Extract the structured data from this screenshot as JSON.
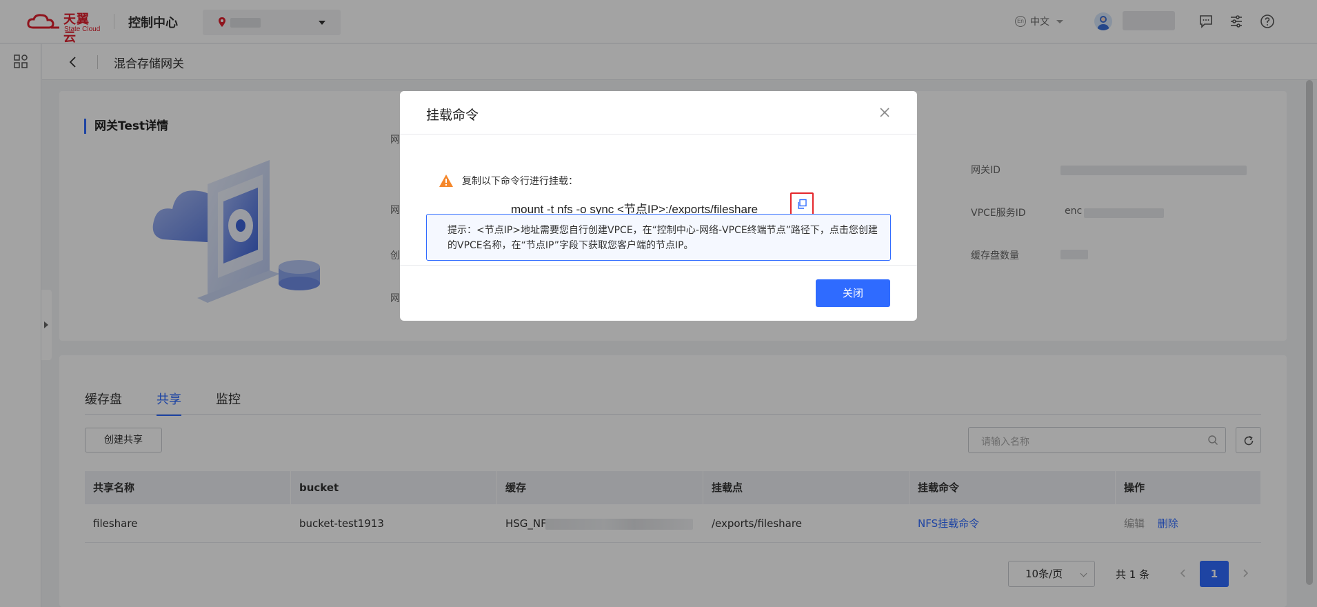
{
  "topbar": {
    "logo_cn": "天翼云",
    "logo_en": "State Cloud",
    "console_title": "控制中心",
    "language": "中文",
    "lang_badge": "En"
  },
  "subheader": {
    "title": "混合存储网关"
  },
  "detail": {
    "title": "网关Test详情",
    "labels_left": [
      "网",
      "网",
      "创",
      "网"
    ],
    "labels_right": [
      "网关ID",
      "VPCE服务ID",
      "缓存盘数量"
    ],
    "vpce_prefix": "enc"
  },
  "tabs": [
    {
      "label": "缓存盘",
      "active": false
    },
    {
      "label": "共享",
      "active": true
    },
    {
      "label": "监控",
      "active": false
    }
  ],
  "toolbar": {
    "create_label": "创建共享",
    "search_placeholder": "请输入名称"
  },
  "table": {
    "headers": [
      "共享名称",
      "bucket",
      "缓存",
      "挂载点",
      "挂载命令",
      "操作"
    ],
    "rows": [
      {
        "name": "fileshare",
        "bucket": "bucket-test1913",
        "cache": "HSG_NF",
        "mount_point": "/exports/fileshare",
        "mount_cmd": "NFS挂载命令",
        "op_edit": "编辑",
        "op_delete": "删除"
      }
    ]
  },
  "pagination": {
    "page_size": "10条/页",
    "total": "共 1 条",
    "current_page": "1"
  },
  "modal": {
    "title": "挂载命令",
    "warning": "复制以下命令行进行挂载：",
    "command": "mount -t nfs -o sync <节点IP>:/exports/fileshare",
    "tip": "提示：<节点IP>地址需要您自行创建VPCE，在“控制中心-网络-VPCE终端节点”路径下，点击您创建的VPCE名称，在“节点IP”字段下获取您客户端的节点IP。",
    "close_label": "关闭"
  },
  "colors": {
    "brand_red": "#e0202e",
    "primary_blue": "#2f6bff",
    "highlight_red": "#e5262b",
    "warning_orange": "#f5872b"
  }
}
